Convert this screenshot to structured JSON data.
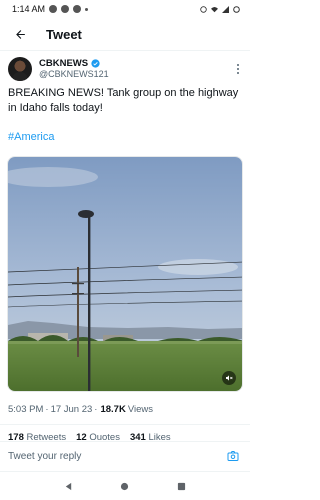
{
  "status_bar": {
    "time": "1:14 AM"
  },
  "header": {
    "title": "Tweet",
    "back_icon": "arrow-left-icon"
  },
  "tweet": {
    "author_name": "CBKNEWS",
    "handle": "@CBKNEWS121",
    "text": "BREAKING NEWS! Tank group on the highway in Idaho falls today!",
    "hashtag": "#America",
    "time": "5:03 PM",
    "date": "17 Jun 23",
    "views_count": "18.7K",
    "views_label": "Views"
  },
  "stats": {
    "retweets_count": "178",
    "retweets_label": "Retweets",
    "quotes_count": "12",
    "quotes_label": "Quotes",
    "likes_count": "341",
    "likes_label": "Likes"
  },
  "reply": {
    "placeholder": "Tweet your reply"
  },
  "colors": {
    "accent": "#1d9bf0",
    "text": "#0f1419",
    "secondary": "#536471"
  }
}
